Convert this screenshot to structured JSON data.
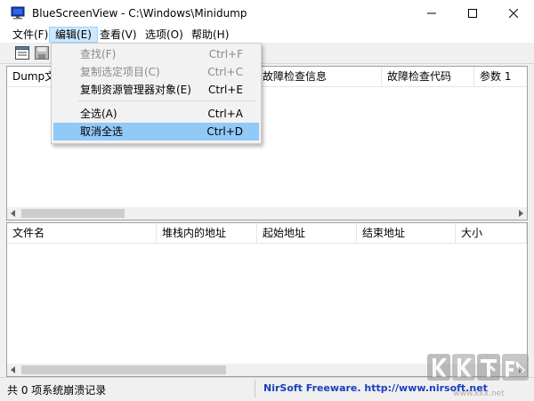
{
  "window": {
    "title": "BlueScreenView  -  C:\\Windows\\Minidump"
  },
  "menubar": [
    {
      "label": "文件(F)"
    },
    {
      "label": "编辑(E)"
    },
    {
      "label": "查看(V)"
    },
    {
      "label": "选项(O)"
    },
    {
      "label": "帮助(H)"
    }
  ],
  "top_table": {
    "columns": [
      "Dump文件",
      "故障检查信息",
      "故障检查代码",
      "参数 1"
    ]
  },
  "bottom_table": {
    "columns": [
      "文件名",
      "堆栈内的地址",
      "起始地址",
      "结束地址",
      "大小"
    ]
  },
  "edit_menu": {
    "items": [
      {
        "label": "查找(F)",
        "shortcut": "Ctrl+F",
        "enabled": false
      },
      {
        "label": "复制选定项目(C)",
        "shortcut": "Ctrl+C",
        "enabled": false
      },
      {
        "label": "复制资源管理器对象(E)",
        "shortcut": "Ctrl+E",
        "enabled": true
      },
      {
        "label": "全选(A)",
        "shortcut": "Ctrl+A",
        "enabled": true
      },
      {
        "label": "取消全选",
        "shortcut": "Ctrl+D",
        "enabled": true,
        "highlighted": true
      }
    ]
  },
  "status": {
    "count_text": "共 0 项系统崩溃记录",
    "link_text": "NirSoft Freeware.  http://www.nirsoft.net"
  },
  "watermark": {
    "brand": "KK下载",
    "url": "www.kkx.net"
  },
  "colors": {
    "menu_highlight": "#91c9f7",
    "active_menu": "#cce8ff",
    "link": "#1a3fbf"
  }
}
